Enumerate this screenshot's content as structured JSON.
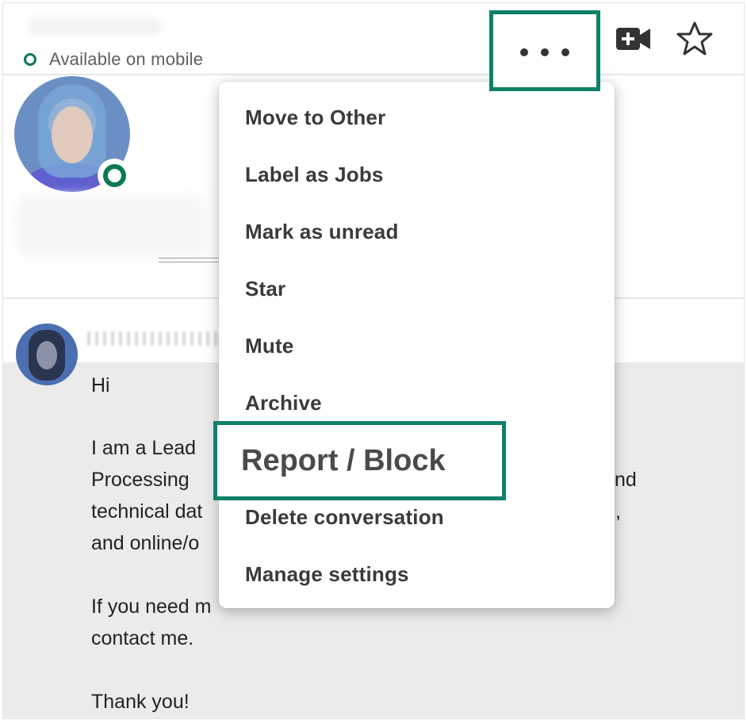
{
  "header": {
    "status_text": "Available on mobile",
    "more_icon": "more-horizontal-icon",
    "video_icon": "video-call-icon",
    "star_icon": "star-outline-icon"
  },
  "menu": {
    "items": [
      {
        "label": "Move to Other"
      },
      {
        "label": "Label as Jobs"
      },
      {
        "label": "Mark as unread"
      },
      {
        "label": "Star"
      },
      {
        "label": "Mute"
      },
      {
        "label": "Archive"
      },
      {
        "label": "Report / Block"
      },
      {
        "label": "Delete conversation"
      },
      {
        "label": "Manage settings"
      }
    ]
  },
  "message": {
    "greeting": "Hi",
    "line1": "I am a Lead",
    "line2": "Processing",
    "line2_tail": "nd",
    "line3": "technical dat",
    "line3_tail": ",",
    "line4": "and online/o",
    "line5": "If you need m",
    "line6": "contact me.",
    "line7": "Thank you!"
  },
  "colors": {
    "accent": "#0e8169",
    "online": "#0a7a52",
    "message_bg": "#ebebeb"
  }
}
